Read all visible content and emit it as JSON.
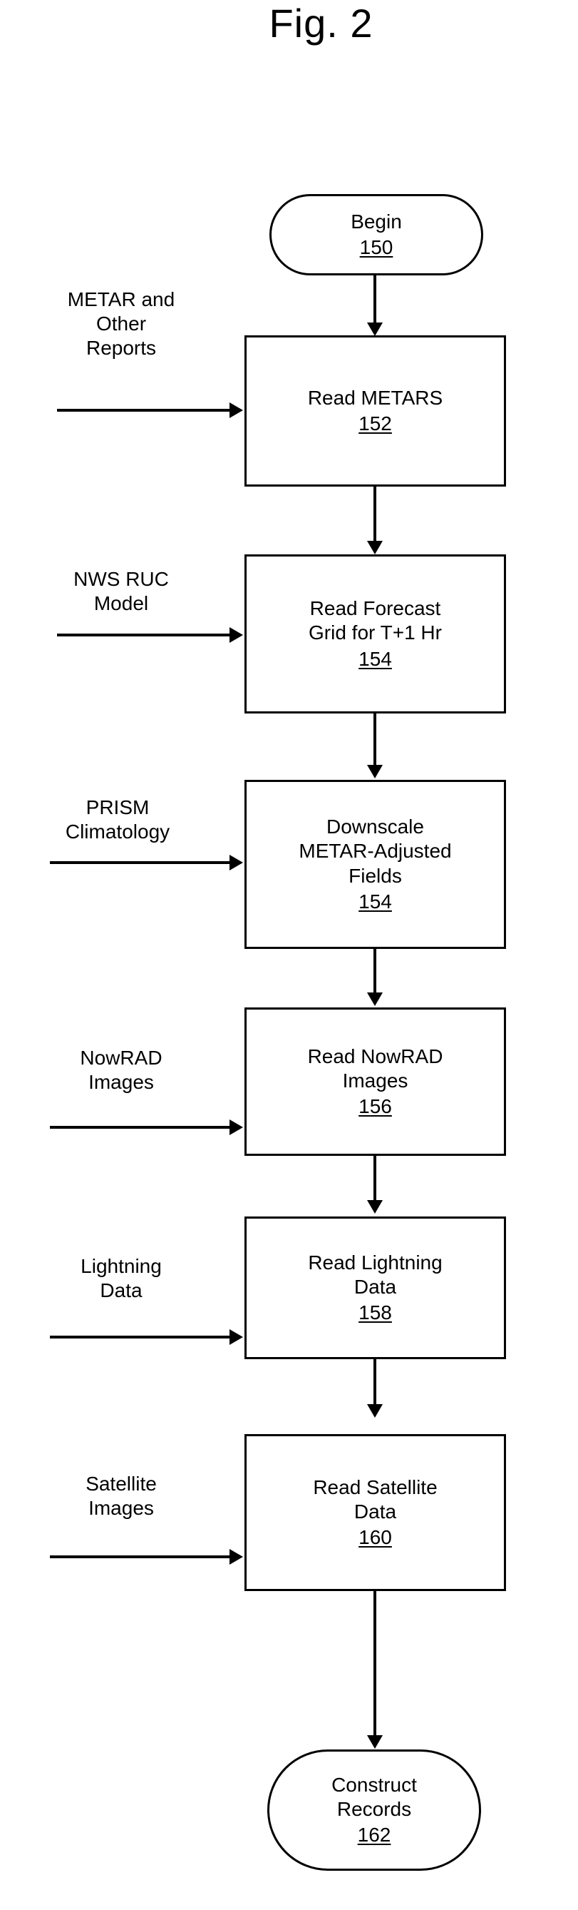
{
  "figure": {
    "title": "Fig. 2"
  },
  "flow": {
    "start": {
      "label": "Begin",
      "ref": "150"
    },
    "end": {
      "line1": "Construct",
      "line2": "Records",
      "ref": "162"
    },
    "steps": [
      {
        "source": {
          "line1": "METAR and",
          "line2": "Other",
          "line3": "Reports"
        },
        "process": {
          "line1": "Read METARS",
          "line2": "",
          "ref": "152"
        }
      },
      {
        "source": {
          "line1": "NWS RUC",
          "line2": "Model",
          "line3": ""
        },
        "process": {
          "line1": "Read Forecast",
          "line2": "Grid for T+1 Hr",
          "ref": "154"
        }
      },
      {
        "source": {
          "line1": "PRISM",
          "line2": "Climatology",
          "line3": ""
        },
        "process": {
          "line1": "Downscale",
          "line2": "METAR-Adjusted",
          "line3": "Fields",
          "ref": "154"
        }
      },
      {
        "source": {
          "line1": "NowRAD",
          "line2": "Images",
          "line3": ""
        },
        "process": {
          "line1": "Read NowRAD",
          "line2": "Images",
          "ref": "156"
        }
      },
      {
        "source": {
          "line1": "Lightning",
          "line2": "Data",
          "line3": ""
        },
        "process": {
          "line1": "Read Lightning",
          "line2": "Data",
          "ref": "158"
        }
      },
      {
        "source": {
          "line1": "Satellite",
          "line2": "Images",
          "line3": ""
        },
        "process": {
          "line1": "Read Satellite",
          "line2": "Data",
          "ref": "160"
        }
      }
    ]
  },
  "colors": {
    "ink": "#000000",
    "paper": "#ffffff"
  }
}
